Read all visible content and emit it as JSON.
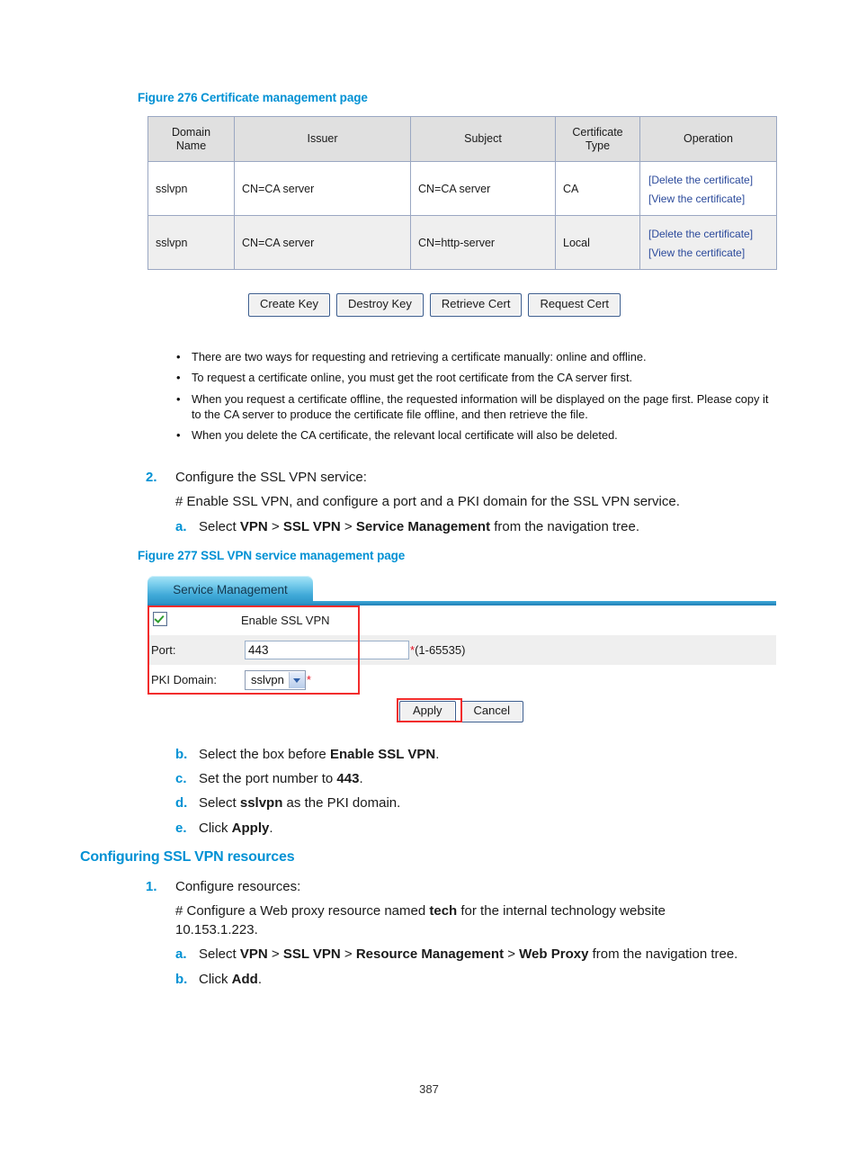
{
  "figure276": {
    "title": "Figure 276 Certificate management page",
    "table": {
      "headers": [
        "Domain\nName",
        "Issuer",
        "Subject",
        "Certificate\nType",
        "Operation"
      ],
      "header_domain_line1": "Domain",
      "header_domain_line2": "Name",
      "header_issuer": "Issuer",
      "header_subject": "Subject",
      "header_cert_line1": "Certificate",
      "header_cert_line2": "Type",
      "header_operation": "Operation",
      "rows": [
        {
          "domain": "sslvpn",
          "issuer": "CN=CA server",
          "subject": "CN=CA server",
          "type": "CA",
          "op_delete": "[Delete the certificate]",
          "op_view": "[View the certificate]"
        },
        {
          "domain": "sslvpn",
          "issuer": "CN=CA server",
          "subject": "CN=http-server",
          "type": "Local",
          "op_delete": "[Delete the certificate]",
          "op_view": "[View the certificate]"
        }
      ]
    },
    "buttons": [
      "Create Key",
      "Destroy Key",
      "Retrieve Cert",
      "Request Cert"
    ]
  },
  "notes": [
    "There are two ways for requesting and retrieving a certificate manually: online and offline.",
    "To request a certificate online, you must get the root certificate from the CA server first.",
    "When you request a certificate offline, the requested information will be displayed on the page first. Please copy it to the CA server to produce the certificate file offline, and then retrieve the file.",
    "When you delete the CA certificate, the relevant local certificate will also be deleted."
  ],
  "step2": {
    "num": "2.",
    "text": "Configure the SSL VPN service:",
    "hash_line": "# Enable SSL VPN, and configure a port and a PKI domain for the SSL VPN service.",
    "a": {
      "marker": "a.",
      "pre": "Select ",
      "b1": "VPN",
      "sep1": " > ",
      "b2": "SSL VPN",
      "sep2": " > ",
      "b3": "Service Management",
      "post": " from the navigation tree."
    }
  },
  "figure277": {
    "title": "Figure 277 SSL VPN service management page",
    "tab_label": "Service Management",
    "enable_label": "Enable SSL VPN",
    "enable_checked": true,
    "port_label": "Port:",
    "port_value": "443",
    "port_star": "*",
    "port_range": "(1-65535)",
    "pki_label": "PKI Domain:",
    "pki_value": "sslvpn",
    "pki_star": "*",
    "apply_label": "Apply",
    "cancel_label": "Cancel",
    "highlight_color": "#f22c2c"
  },
  "substeps": [
    {
      "marker": "b.",
      "pre": "Select the box before ",
      "bold": "Enable SSL VPN",
      "post": "."
    },
    {
      "marker": "c.",
      "pre": "Set the port number to ",
      "bold": "443",
      "post": "."
    },
    {
      "marker": "d.",
      "pre": "Select ",
      "bold": "sslvpn",
      "post": " as the PKI domain."
    },
    {
      "marker": "e.",
      "pre": "Click ",
      "bold": "Apply",
      "post": "."
    }
  ],
  "resources_section": {
    "heading": "Configuring SSL VPN resources",
    "step1_num": "1.",
    "step1_text": "Configure resources:",
    "hash_line_1": "# Configure a Web proxy resource named ",
    "hash_bold": "tech",
    "hash_line_2": " for the internal technology website",
    "hash_line_3": "10.153.1.223.",
    "a": {
      "marker": "a.",
      "pre": "Select ",
      "b1": "VPN",
      "sep1": " > ",
      "b2": "SSL VPN",
      "sep2": " > ",
      "b3": "Resource Management",
      "sep3": " > ",
      "b4": "Web Proxy",
      "post": " from the navigation tree."
    },
    "b": {
      "marker": "b.",
      "pre": "Click ",
      "bold": "Add",
      "post": "."
    }
  },
  "page_number": "387"
}
